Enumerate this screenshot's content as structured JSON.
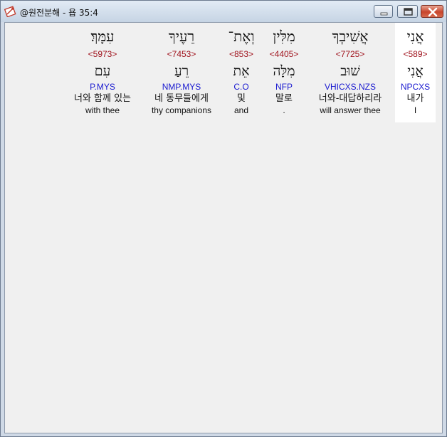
{
  "window": {
    "title": "@원전분해 - 욥 35:4"
  },
  "words": [
    {
      "hebrew": "אֲנִי",
      "strong": "<589>",
      "root": "אֲנִי",
      "morph": "NPCXS",
      "korean": "내가",
      "english": "I",
      "selected": true
    },
    {
      "hebrew": "אֲשִׁיבְךָ",
      "strong": "<7725>",
      "root": "שׁוּב",
      "morph": "VHICXS.NZS",
      "korean": "너와-대답하리라",
      "english": "will answer thee"
    },
    {
      "hebrew": "מִלִּין",
      "strong": "<4405>",
      "root": "מִלָּה",
      "morph": "NFP",
      "korean": "말로",
      "english": "."
    },
    {
      "hebrew": "וְאֶת־",
      "strong": "<853>",
      "root": "אֵת",
      "morph": "C.O",
      "korean": "및",
      "english": "and"
    },
    {
      "hebrew": "רֵעֶיךָ",
      "strong": "<7453>",
      "root": "רֵעַ",
      "morph": "NMP.MYS",
      "korean": "네 동무들에게",
      "english": "thy companions"
    },
    {
      "hebrew": "עִמָּךְ׃",
      "strong": "<5973>",
      "root": "עִם",
      "morph": "P.MYS",
      "korean": "너와 함께 있는",
      "english": "with thee"
    }
  ]
}
